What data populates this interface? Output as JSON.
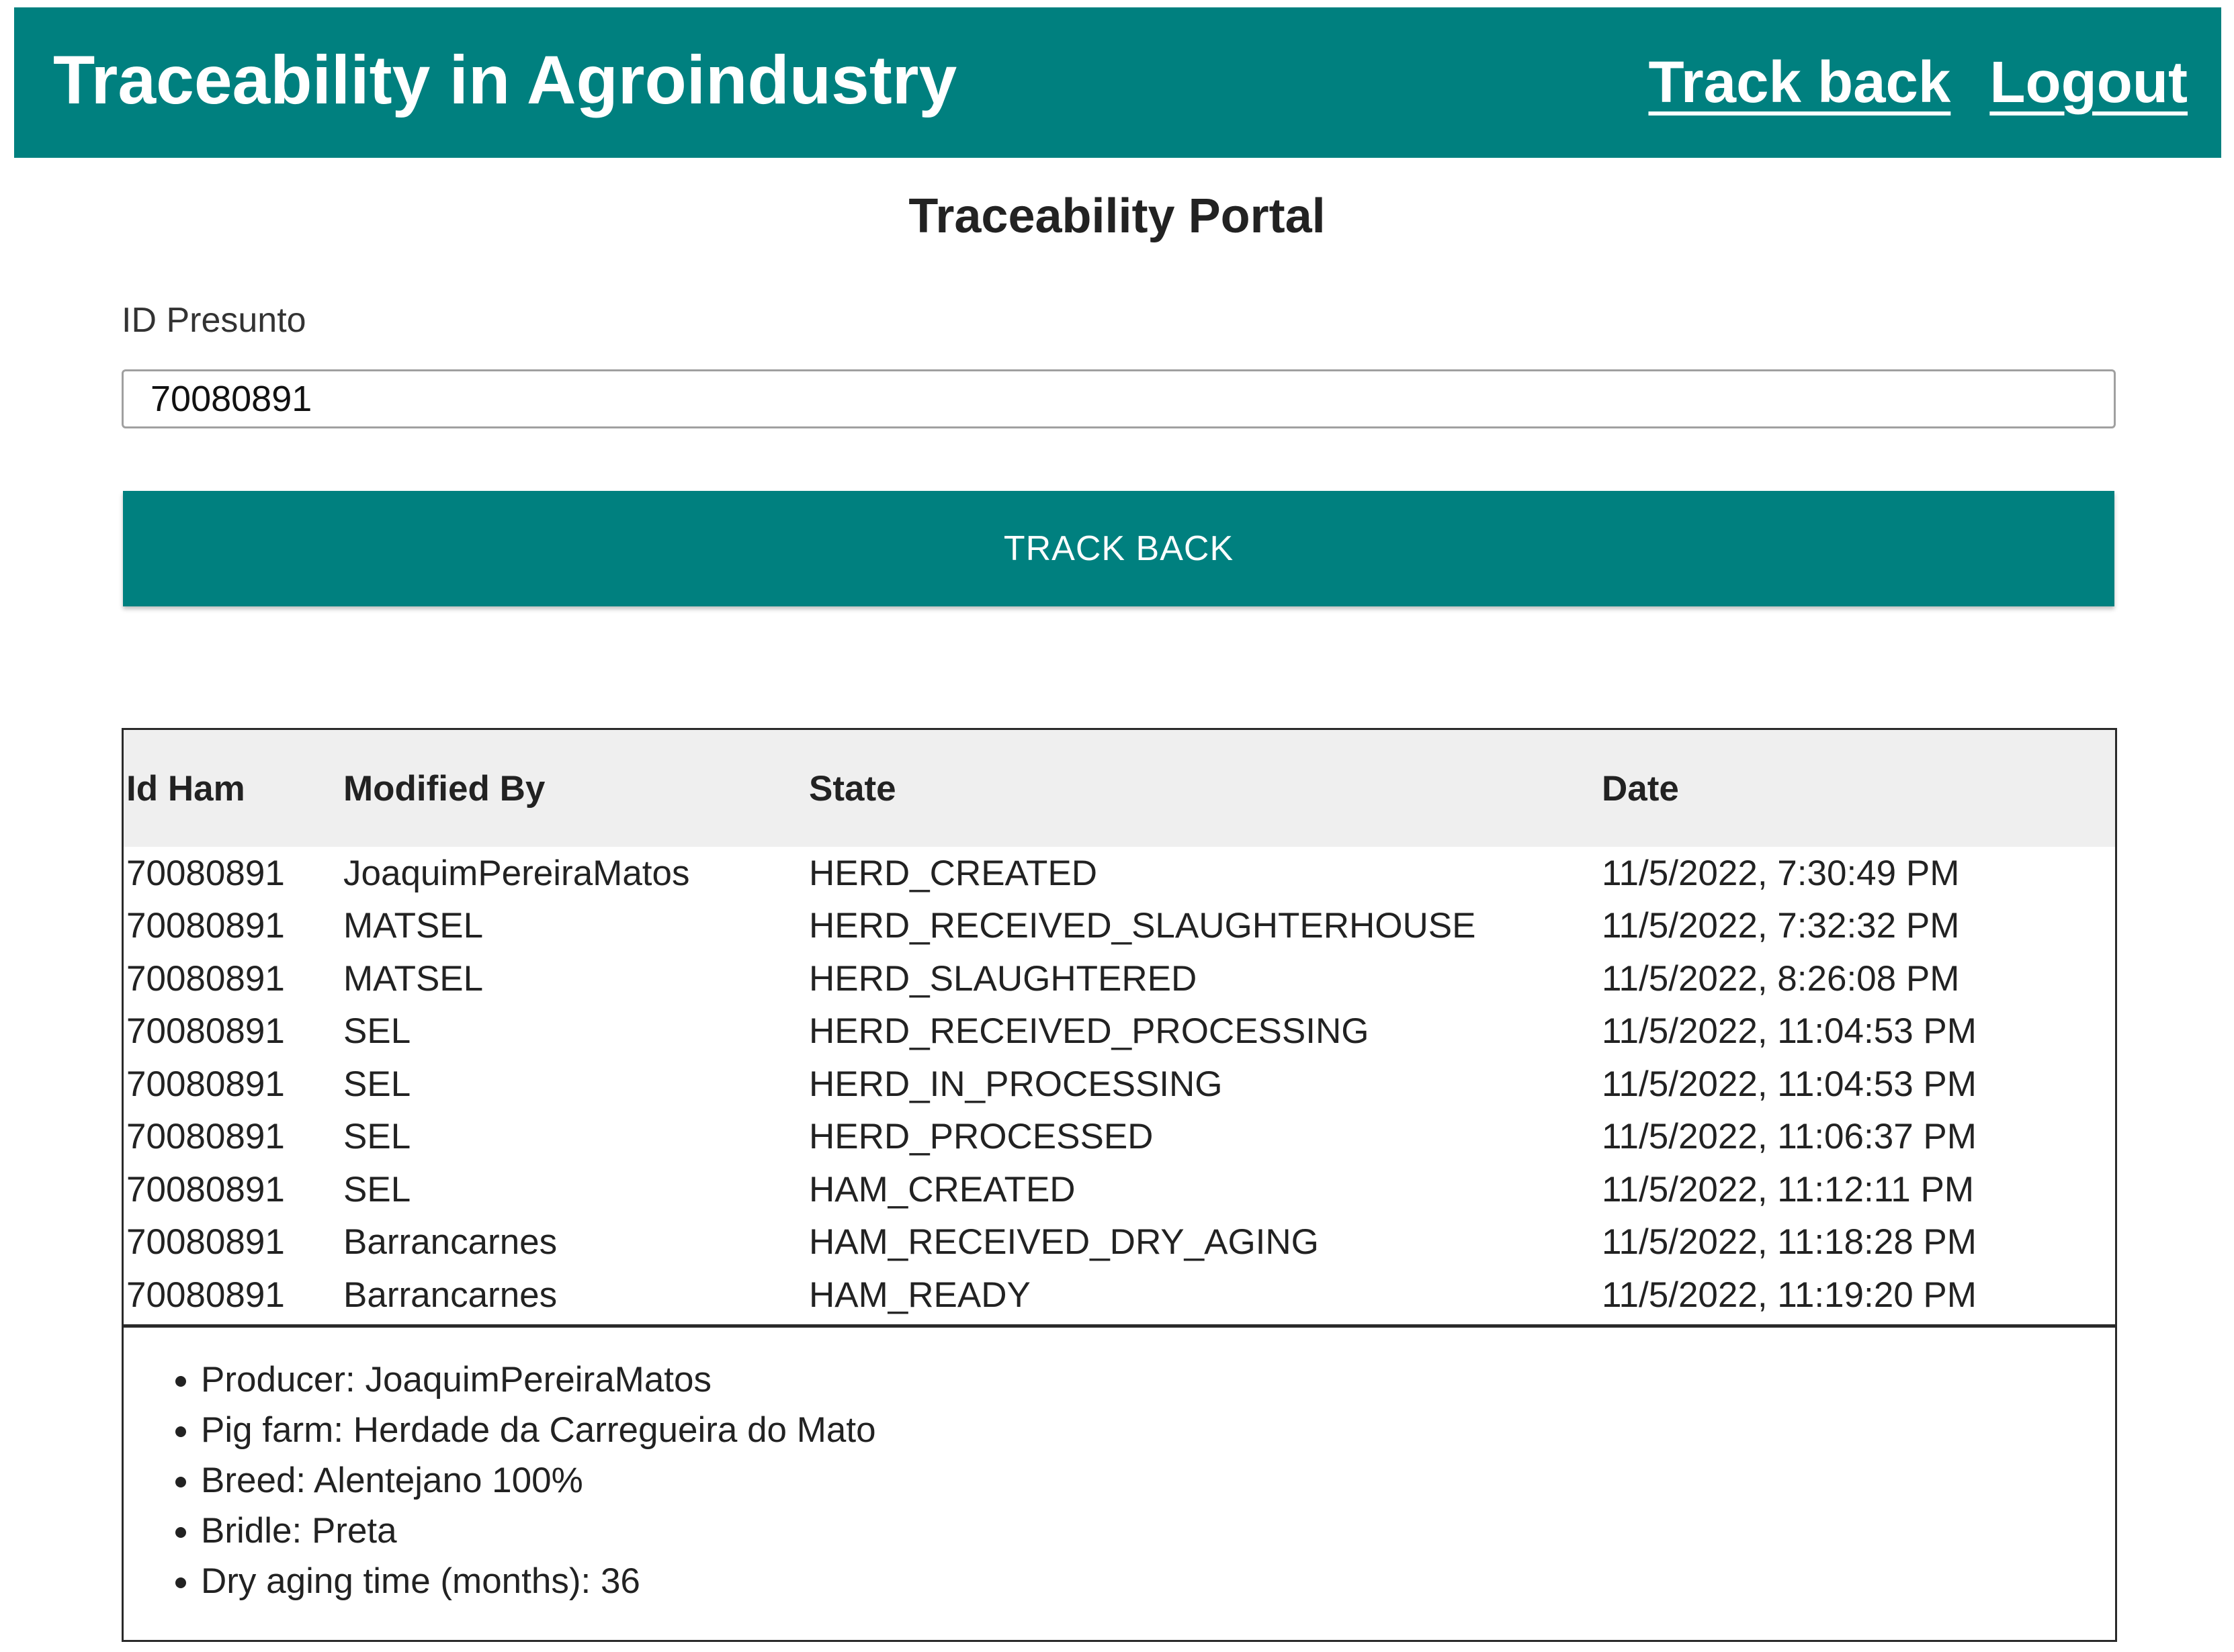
{
  "header": {
    "title": "Traceability in Agroindustry",
    "nav": {
      "track_back": "Track back",
      "logout": "Logout"
    },
    "background_color": "#00807f"
  },
  "portal": {
    "title": "Traceability Portal",
    "id_label": "ID Presunto",
    "id_value": "70080891",
    "button_label": "TRACK BACK"
  },
  "table": {
    "headers": {
      "id": "Id Ham",
      "modified_by": "Modified By",
      "state": "State",
      "date": "Date"
    },
    "rows": [
      {
        "id": "70080891",
        "modified_by": "JoaquimPereiraMatos",
        "state": "HERD_CREATED",
        "date": "11/5/2022, 7:30:49 PM"
      },
      {
        "id": "70080891",
        "modified_by": "MATSEL",
        "state": "HERD_RECEIVED_SLAUGHTERHOUSE",
        "date": "11/5/2022, 7:32:32 PM"
      },
      {
        "id": "70080891",
        "modified_by": "MATSEL",
        "state": "HERD_SLAUGHTERED",
        "date": "11/5/2022, 8:26:08 PM"
      },
      {
        "id": "70080891",
        "modified_by": "SEL",
        "state": "HERD_RECEIVED_PROCESSING",
        "date": "11/5/2022, 11:04:53 PM"
      },
      {
        "id": "70080891",
        "modified_by": "SEL",
        "state": "HERD_IN_PROCESSING",
        "date": "11/5/2022, 11:04:53 PM"
      },
      {
        "id": "70080891",
        "modified_by": "SEL",
        "state": "HERD_PROCESSED",
        "date": "11/5/2022, 11:06:37 PM"
      },
      {
        "id": "70080891",
        "modified_by": "SEL",
        "state": "HAM_CREATED",
        "date": "11/5/2022, 11:12:11 PM"
      },
      {
        "id": "70080891",
        "modified_by": "Barrancarnes",
        "state": "HAM_RECEIVED_DRY_AGING",
        "date": "11/5/2022, 11:18:28 PM"
      },
      {
        "id": "70080891",
        "modified_by": "Barrancarnes",
        "state": "HAM_READY",
        "date": "11/5/2022, 11:19:20 PM"
      }
    ]
  },
  "details": [
    "Producer: JoaquimPereiraMatos",
    "Pig farm: Herdade da Carregueira do Mato",
    "Breed: Alentejano 100%",
    "Bridle: Preta",
    "Dry aging time (months): 36"
  ]
}
